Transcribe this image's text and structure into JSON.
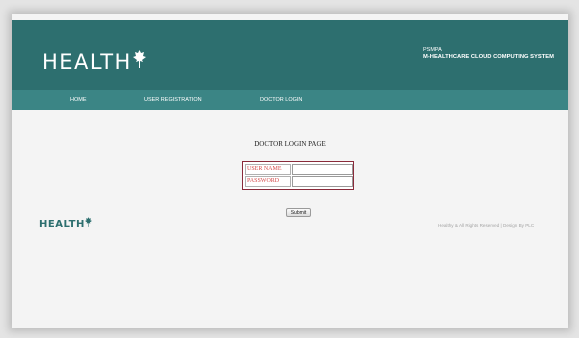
{
  "header": {
    "logo_text": "HEALTH",
    "system_code": "PSMPA",
    "system_name": "M-HEALTHCARE CLOUD COMPUTING SYSTEM"
  },
  "nav": {
    "items": [
      {
        "label": "HOME"
      },
      {
        "label": "USER REGISTRATION"
      },
      {
        "label": "DOCTOR LOGIN"
      }
    ]
  },
  "main": {
    "page_title": "DOCTOR LOGIN PAGE",
    "form": {
      "username_label": "USER NAME",
      "username_value": "",
      "password_label": "PASSWORD",
      "password_value": "",
      "submit_label": "Submit"
    }
  },
  "footer": {
    "logo_text": "HEALTH",
    "copyright": "Healthy & All Rights Reserved | Design By PLC"
  },
  "colors": {
    "header_bg": "#2d6f6f",
    "nav_bg": "#3b8585",
    "label_red": "#d44a4a",
    "form_border": "#8a2a3a"
  }
}
